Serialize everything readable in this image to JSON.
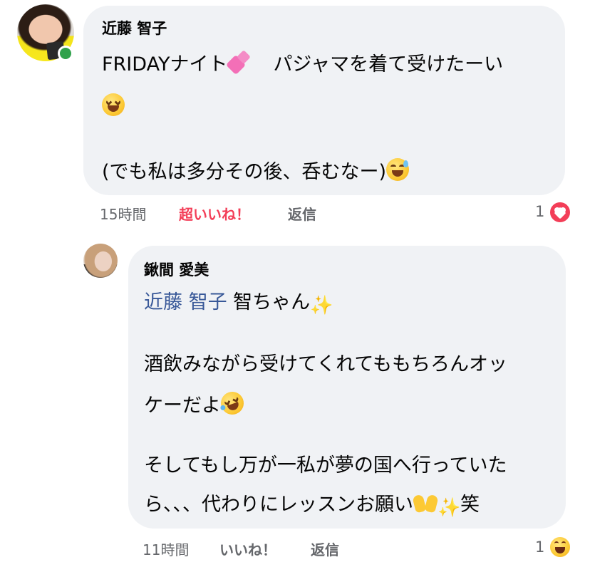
{
  "comment1": {
    "author": "近藤 智子",
    "line1_text": "FRIDAYナイト",
    "line1_after": "パジャマを着て受けたーい",
    "line3_text": "(でも私は多分その後、呑むなー)",
    "time": "15時間",
    "like_label": "超いいね！",
    "reply_label": "返信",
    "reaction_count": "1",
    "reaction_type": "love-icon",
    "online": true
  },
  "comment2": {
    "author": "鍬間 愛美",
    "mention": "近藤 智子",
    "line1_after_mention": " 智ちゃん",
    "line2_text": "酒飲みながら受けてくれてももちろんオッ",
    "line3_text": "ケーだよ",
    "line4_text": "そしてもし万が一私が夢の国へ行っていた",
    "line5_text": "ら、、、代わりにレッスンお願い",
    "line5_end": "笑",
    "time": "11時間",
    "like_label": "いいね！",
    "reply_label": "返信",
    "reaction_count": "1",
    "reaction_type": "haha-icon"
  },
  "colors": {
    "bubble": "#f0f2f5",
    "secondary_text": "#65676b",
    "mention": "#385898",
    "love_reaction": "#f33e58",
    "online": "#31a24c"
  }
}
